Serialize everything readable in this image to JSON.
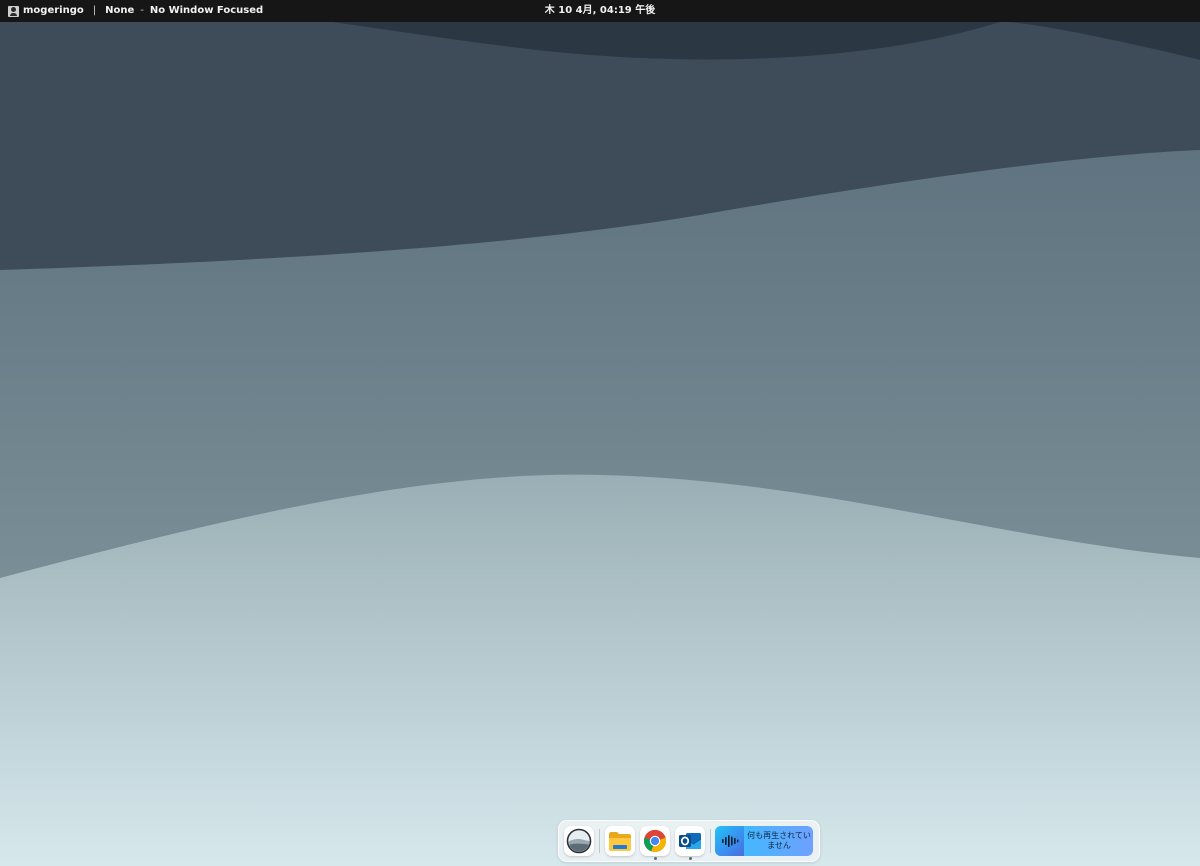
{
  "topbar": {
    "user_name": "mogeringo",
    "separator": "|",
    "workspace": "None",
    "dash": "-",
    "focused_window": "No Window Focused",
    "clock": "木 10 4月, 04:19 午後"
  },
  "dock": {
    "items": [
      {
        "name": "start-menu",
        "icon": "landscape-orb-icon",
        "running": false
      },
      {
        "name": "file-explorer",
        "icon": "folder-icon",
        "running": false
      },
      {
        "name": "google-chrome",
        "icon": "chrome-icon",
        "running": true
      },
      {
        "name": "outlook",
        "icon": "outlook-icon",
        "running": true
      }
    ],
    "media": {
      "icon": "audio-wave-icon",
      "status": "何も再生されていません"
    }
  },
  "colors": {
    "topbar_bg": "#161616",
    "wallpaper_top": "#2b3642",
    "wallpaper_bottom": "#d6e8ec",
    "media_accent": "#46b6ff"
  }
}
